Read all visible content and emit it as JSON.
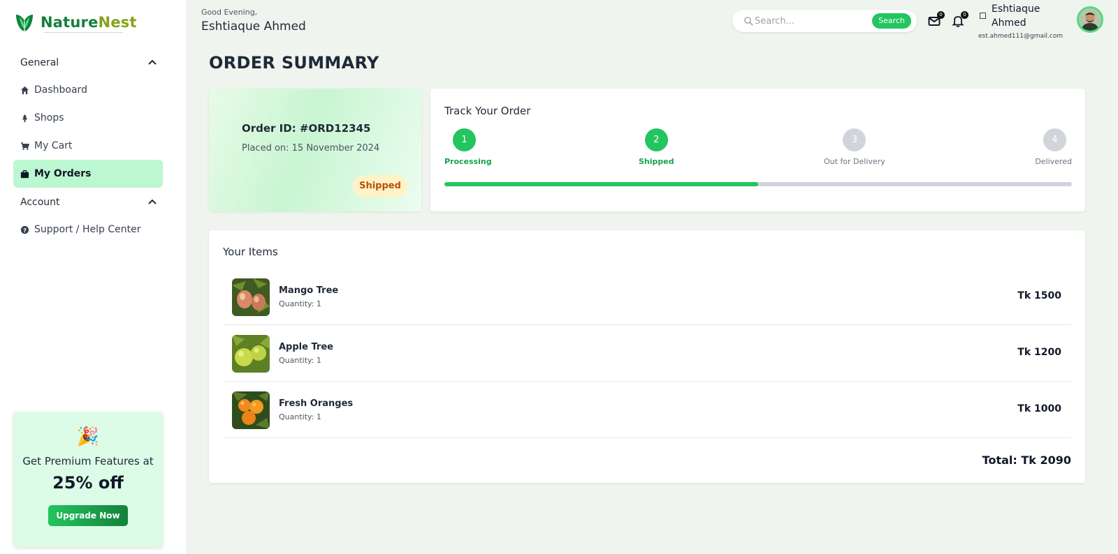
{
  "brand": {
    "name_part1": "Nature",
    "name_part2": "Nest",
    "color_primary": "#15803d",
    "color_secondary": "#84a31a"
  },
  "sidebar": {
    "sections": [
      {
        "label": "General",
        "items": [
          {
            "label": "Dashboard",
            "icon": "home-icon"
          },
          {
            "label": "Shops",
            "icon": "tree-icon"
          },
          {
            "label": "My Cart",
            "icon": "cart-icon"
          },
          {
            "label": "My Orders",
            "icon": "bag-icon",
            "active": true
          }
        ]
      },
      {
        "label": "Account",
        "items": [
          {
            "label": "Support / Help Center",
            "icon": "question-icon"
          }
        ]
      }
    ],
    "promo": {
      "emoji": "🎉",
      "text": "Get Premium Features at",
      "discount": "25% off",
      "button": "Upgrade Now"
    }
  },
  "header": {
    "greeting": "Good Evening,",
    "user_name": "Eshtiaque Ahmed",
    "search": {
      "placeholder": "Search...",
      "button": "Search"
    },
    "mail_count": "0",
    "notification_count": "0",
    "profile": {
      "name": "Eshtiaque Ahmed",
      "email": "est.ahmed111@gmail.com"
    }
  },
  "main": {
    "title": "ORDER SUMMARY",
    "order": {
      "id_label": "Order ID: #ORD12345",
      "placed_label": "Placed on: 15 November 2024",
      "status": "Shipped"
    },
    "tracking": {
      "title": "Track Your Order",
      "steps": [
        {
          "num": "1",
          "label": "Processing",
          "done": true
        },
        {
          "num": "2",
          "label": "Shipped",
          "done": true
        },
        {
          "num": "3",
          "label": "Out for Delivery",
          "done": false
        },
        {
          "num": "4",
          "label": "Delivered",
          "done": false
        }
      ],
      "progress_percent": 50,
      "accent": "#22c55e"
    },
    "items_title": "Your Items",
    "items": [
      {
        "name": "Mango Tree",
        "quantity": "Quantity: 1",
        "price": "Tk 1500"
      },
      {
        "name": "Apple Tree",
        "quantity": "Quantity: 1",
        "price": "Tk 1200"
      },
      {
        "name": "Fresh Oranges",
        "quantity": "Quantity: 1",
        "price": "Tk 1000"
      }
    ],
    "total": "Total: Tk 2090"
  }
}
